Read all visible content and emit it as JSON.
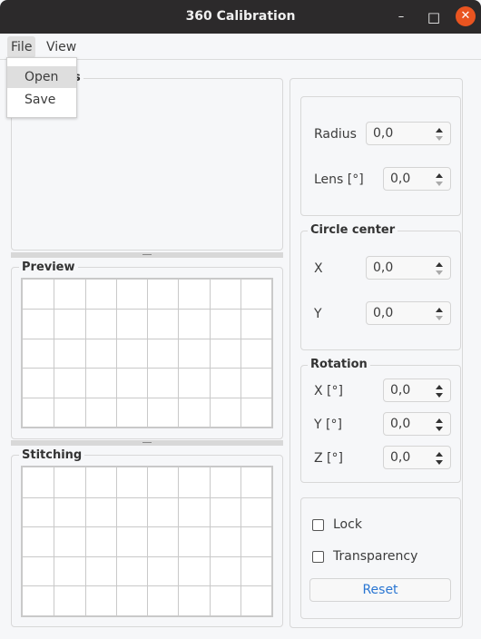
{
  "window": {
    "title": "360 Calibration",
    "minimize": "–",
    "maximize": "□",
    "close": "✕"
  },
  "menubar": {
    "items": [
      {
        "label": "File"
      },
      {
        "label": "View"
      }
    ]
  },
  "file_menu": {
    "items": [
      {
        "label": "Open",
        "highlighted": true
      },
      {
        "label": "Save"
      }
    ]
  },
  "left": {
    "top_group_title_partial": "s",
    "preview_title": "Preview",
    "stitching_title": "Stitching",
    "grid": {
      "columns": 8,
      "rows": 5
    }
  },
  "lens_group": {
    "radius_label": "Radius",
    "radius_value": "0,0",
    "lens_label": "Lens [°]",
    "lens_value": "0,0"
  },
  "circle_center": {
    "title": "Circle center",
    "x_label": "X",
    "x_value": "0,0",
    "y_label": "Y",
    "y_value": "0,0"
  },
  "rotation": {
    "title": "Rotation",
    "x_label": "X [°]",
    "x_value": "0,0",
    "y_label": "Y [°]",
    "y_value": "0,0",
    "z_label": "Z [°]",
    "z_value": "0,0"
  },
  "options": {
    "lock_label": "Lock",
    "lock_checked": false,
    "transparency_label": "Transparency",
    "transparency_checked": false,
    "reset_label": "Reset"
  },
  "colors": {
    "titlebar": "#2c2a2b",
    "close_button": "#e95420",
    "accent": "#2a76d2"
  }
}
